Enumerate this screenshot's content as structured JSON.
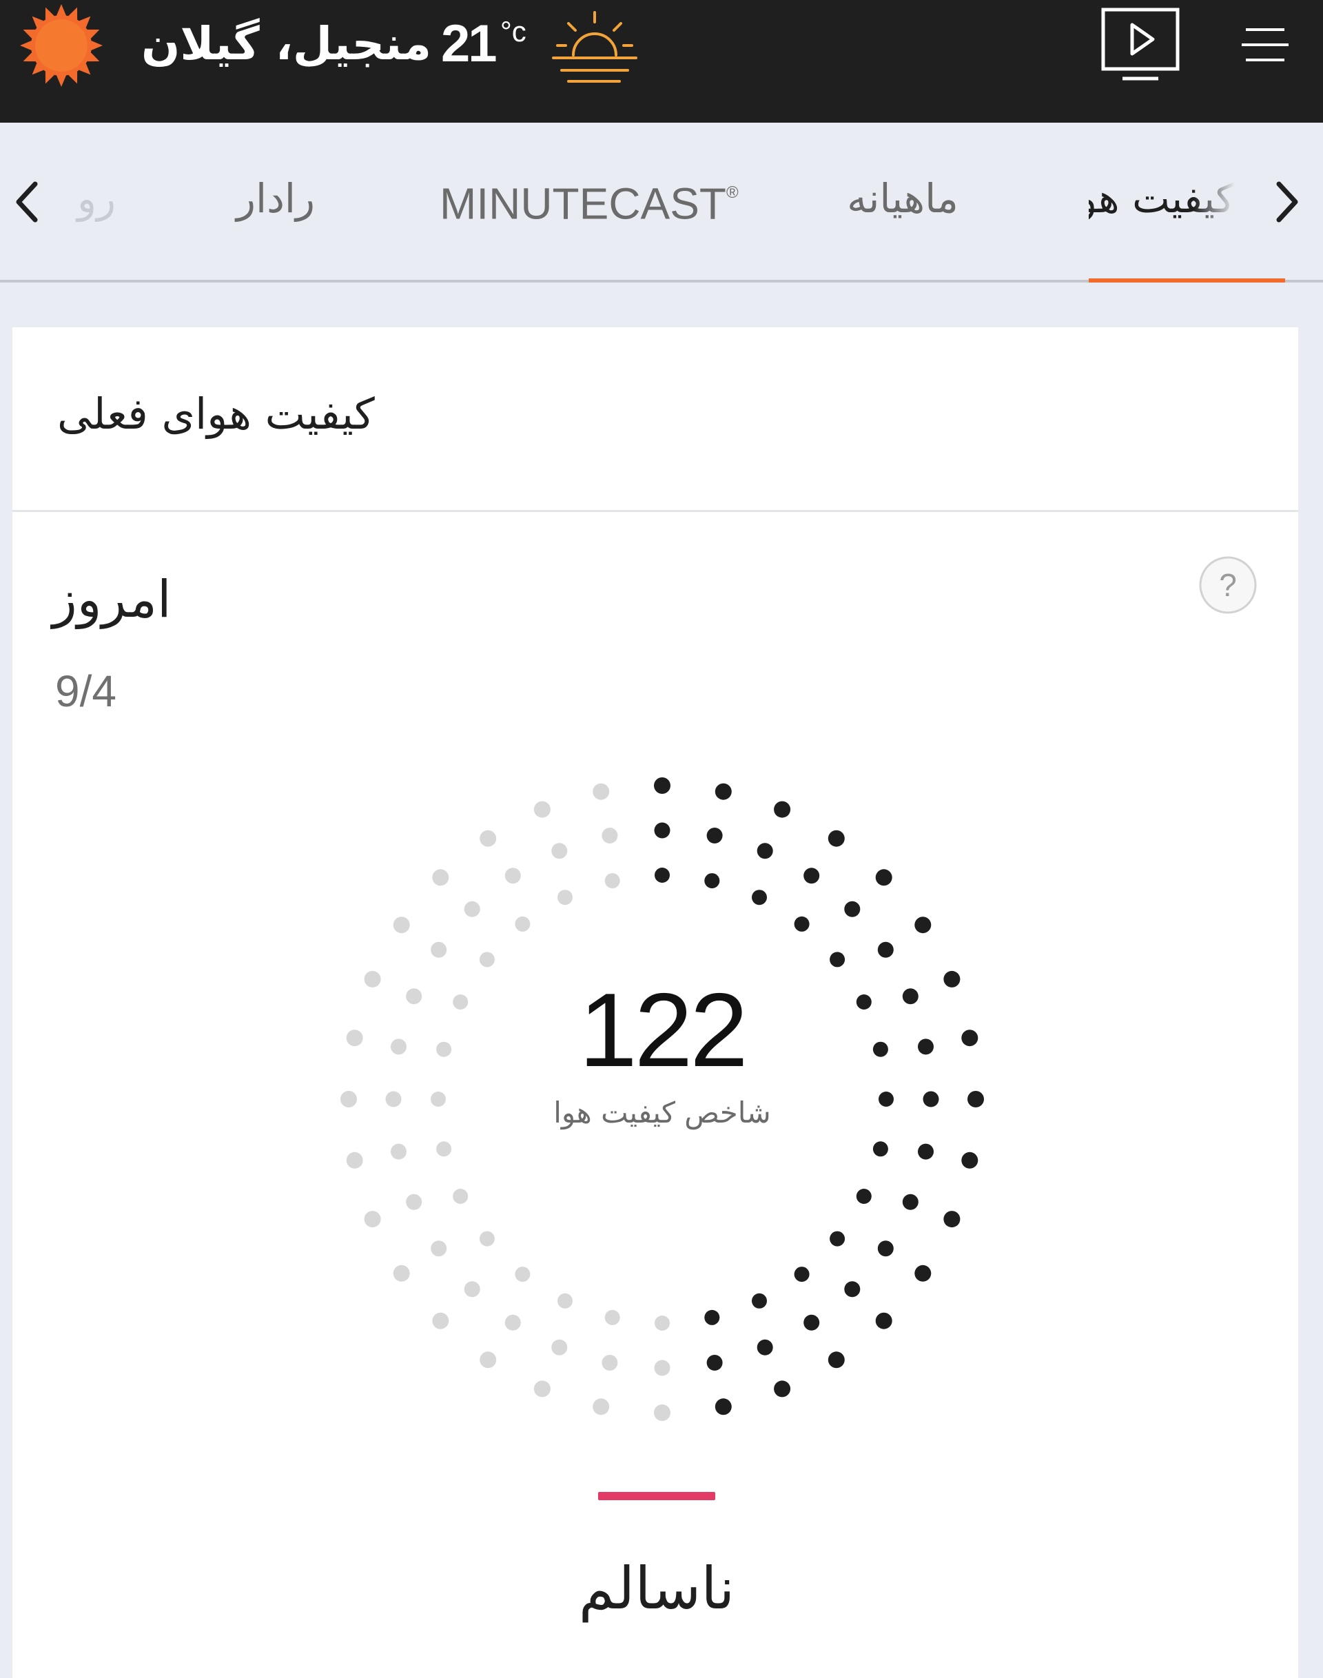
{
  "header": {
    "location": "منجیل، گیلان",
    "temperature": "21",
    "temp_unit": "°c",
    "logo_icon": "sun-logo-icon",
    "weather_icon": "sunrise-icon",
    "video_icon": "video-play-icon",
    "menu_icon": "hamburger-menu-icon",
    "colors": {
      "background": "#1f1f1f",
      "logo": "#f26b2c",
      "weather_icon": "#f2a43a"
    }
  },
  "tabs": {
    "items": [
      {
        "id": "ru",
        "label": "رو"
      },
      {
        "id": "radar",
        "label": "رادار"
      },
      {
        "id": "minutecast",
        "label": "MINUTECAST",
        "mark": "®"
      },
      {
        "id": "monthly",
        "label": "ماهیانه"
      },
      {
        "id": "air_quality",
        "label": "کیفیت هوا",
        "active": true
      }
    ],
    "colors": {
      "active_underline": "#f26b2c"
    }
  },
  "card": {
    "title": "کیفیت هوای فعلی",
    "today_label": "امروز",
    "date": "9/4",
    "help_symbol": "?",
    "aqi": {
      "value": "122",
      "label": "شاخص کیفیت هوا",
      "fraction_filled": 0.5,
      "colors": {
        "filled": "#1e1e1e",
        "empty": "#d7d7d7"
      }
    },
    "status": {
      "text": "ناسالم",
      "color": "#e23b66"
    }
  }
}
